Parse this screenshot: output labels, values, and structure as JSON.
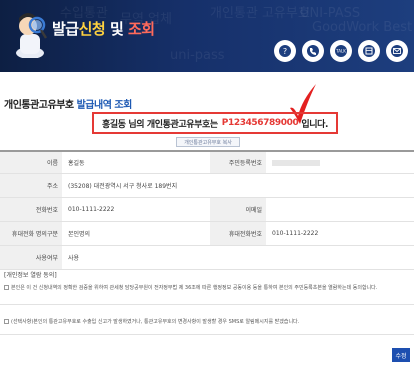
{
  "banner": {
    "title_prefix": "발급",
    "title_highlight": "신청",
    "title_mid": "및",
    "title_suffix": "조회",
    "ghost_text": [
      "수입통관",
      "무역 업체",
      "개인통관 고유부호",
      "UNI-PASS",
      "GoodWork Best",
      "uni-pass"
    ],
    "accent": "#ffd23f",
    "icons": [
      "faq-icon",
      "phone-icon",
      "talk-icon",
      "guide-icon",
      "email-icon"
    ],
    "talk_label": "TALK"
  },
  "heading": {
    "prefix": "개인통관고유부호",
    "suffix": "발급내역 조회"
  },
  "result": {
    "lead": "홍길동 님의 개인통관고유부호는",
    "code": "P123456789000",
    "trail": "입니다.",
    "copy_button": "개인통관고유부호 복사"
  },
  "form": {
    "name_label": "이름",
    "name_value": "홍길동",
    "rrn_label": "주민등록번호",
    "address_label": "주소",
    "address_value": "(35208) 대전광역시 서구 청사로 189번지",
    "phone_label": "전화번호",
    "phone_value": "010-1111-2222",
    "email_label": "이메일",
    "carrier_label": "휴대전화 명의구분",
    "carrier_value": "본인명의",
    "mobile_label": "휴대전화번호",
    "mobile_value": "010-1111-2222",
    "usage_label": "사용여부",
    "usage_value": "사용"
  },
  "notes": {
    "title": "[개인정보 열람 동의]",
    "note1": "본인은 이 건 신청내역의 정확한 검증을 위하여 관세청 담당공무원이 전자정부법 제 36조에 따른 행정정보 공동이용 등을 통하여 본인의 주민등록초본을 열람하는데 동의합니다.",
    "note2": "(선택사항)본인의 통관고유부호로 수출입 신고가 발생하였거나, 통관고유부호의 변경사항이 발생할 경우 SMS로 알림메시지를 받겠습니다."
  },
  "actions": {
    "edit": "수정"
  }
}
